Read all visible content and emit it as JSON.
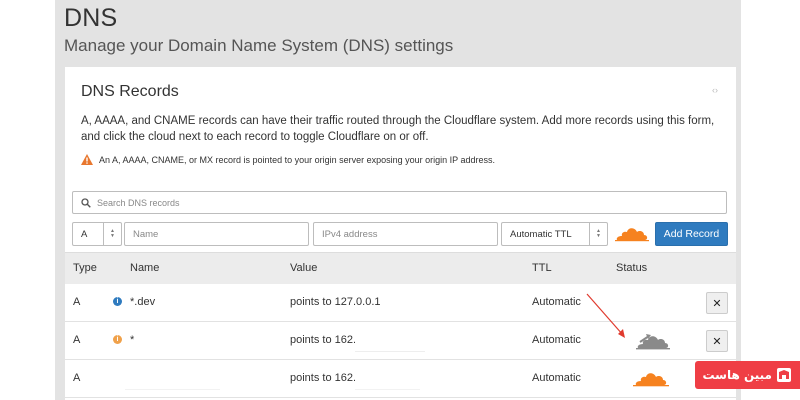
{
  "header": {
    "title": "DNS",
    "subtitle": "Manage your Domain Name System (DNS) settings"
  },
  "card": {
    "title": "DNS Records",
    "description": "A, AAAA, and CNAME records can have their traffic routed through the Cloudflare system. Add more records using this form, and click the cloud next to each record to toggle Cloudflare on or off.",
    "warning": "An A, AAAA, CNAME, or MX record is pointed to your origin server exposing your origin IP address."
  },
  "search": {
    "placeholder": "Search DNS records"
  },
  "form": {
    "type_value": "A",
    "name_placeholder": "Name",
    "ip_placeholder": "IPv4 address",
    "ttl_value": "Automatic TTL",
    "add_label": "Add Record"
  },
  "table": {
    "headers": {
      "type": "Type",
      "name": "Name",
      "value": "Value",
      "ttl": "TTL",
      "status": "Status"
    },
    "rows": [
      {
        "type": "A",
        "name": "*.dev",
        "value": "points to 127.0.0.1",
        "ttl": "Automatic",
        "status": "none"
      },
      {
        "type": "A",
        "name": "*",
        "value": "points to 162.",
        "ttl": "Automatic",
        "status": "dns-only"
      },
      {
        "type": "A",
        "name": "",
        "value": "points to 162.",
        "ttl": "Automatic",
        "status": "proxied"
      }
    ]
  },
  "badge": {
    "text": "مبین هاست"
  },
  "colors": {
    "accent": "#2f7bbf",
    "cloud_orange": "#f6821f",
    "cloud_gray": "#8a8a8a",
    "info_blue": "#2f7bbf",
    "info_orange": "#f0a14a",
    "badge_red": "#ef3e45"
  },
  "icons": {
    "search": "search-icon",
    "warning": "warning-icon",
    "cloud": "cloud-icon",
    "close": "close-icon"
  }
}
